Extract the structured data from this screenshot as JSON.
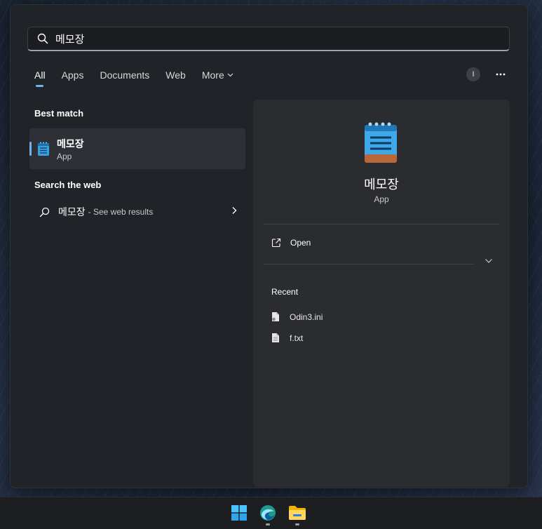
{
  "search": {
    "query": "메모장"
  },
  "tabs": [
    {
      "label": "All"
    },
    {
      "label": "Apps"
    },
    {
      "label": "Documents"
    },
    {
      "label": "Web"
    },
    {
      "label": "More"
    }
  ],
  "account": {
    "initial": "I"
  },
  "best_match": {
    "title": "Best match",
    "name": "메모장",
    "type": "App"
  },
  "search_web": {
    "title": "Search the web",
    "query": "메모장",
    "hint": "- See web results"
  },
  "detail": {
    "name": "메모장",
    "type": "App",
    "open_label": "Open",
    "recent_title": "Recent",
    "recent": [
      {
        "name": "Odin3.ini"
      },
      {
        "name": "f.txt"
      }
    ]
  },
  "colors": {
    "accent": "#6fb4f2",
    "panel": "#202327",
    "detail_panel": "#2a2c30"
  },
  "icons": [
    "search-icon",
    "chevron-down-icon",
    "more-options-icon",
    "notepad-icon",
    "open-external-icon",
    "file-icon",
    "windows-start-icon",
    "browser-icon",
    "file-explorer-icon"
  ]
}
